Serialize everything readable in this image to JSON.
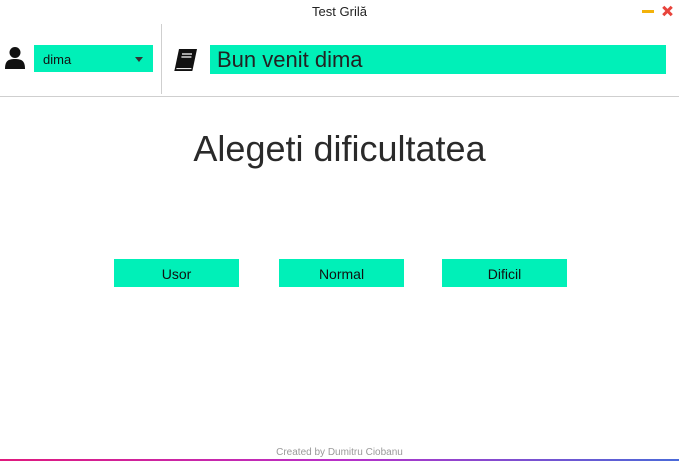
{
  "window": {
    "title": "Test Grilă"
  },
  "header": {
    "user_select": {
      "value": "dima"
    },
    "welcome": "Bun venit dima"
  },
  "main": {
    "heading": "Alegeti dificultatea",
    "buttons": [
      "Usor",
      "Normal",
      "Dificil"
    ]
  },
  "footer": {
    "credit": "Created by Dumitru Ciobanu"
  },
  "colors": {
    "accent": "#00f0b8",
    "close": "#e8443c",
    "minimize": "#f3b20a"
  },
  "icons": [
    "user-icon",
    "book-icon",
    "minimize-icon",
    "close-icon",
    "chevron-down-icon"
  ]
}
